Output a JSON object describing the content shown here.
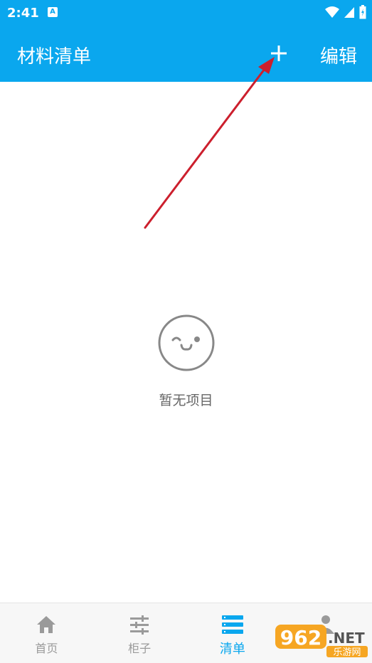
{
  "status_bar": {
    "time": "2:41",
    "app_icon_letter": "A"
  },
  "app_bar": {
    "title": "材料清单",
    "edit_label": "编辑"
  },
  "empty_state": {
    "message": "暂无项目"
  },
  "tabs": [
    {
      "label": "首页",
      "icon": "home-icon"
    },
    {
      "label": "柜子",
      "icon": "sliders-icon"
    },
    {
      "label": "清单",
      "icon": "list-icon",
      "active": true
    },
    {
      "label": "",
      "icon": "profile-icon"
    }
  ],
  "watermark": {
    "number": "962",
    "suffix": ".NET",
    "sub": "乐游网"
  },
  "colors": {
    "primary": "#0aa7ee",
    "arrow": "#cc1f2d",
    "inactive": "#9a9a9a"
  }
}
